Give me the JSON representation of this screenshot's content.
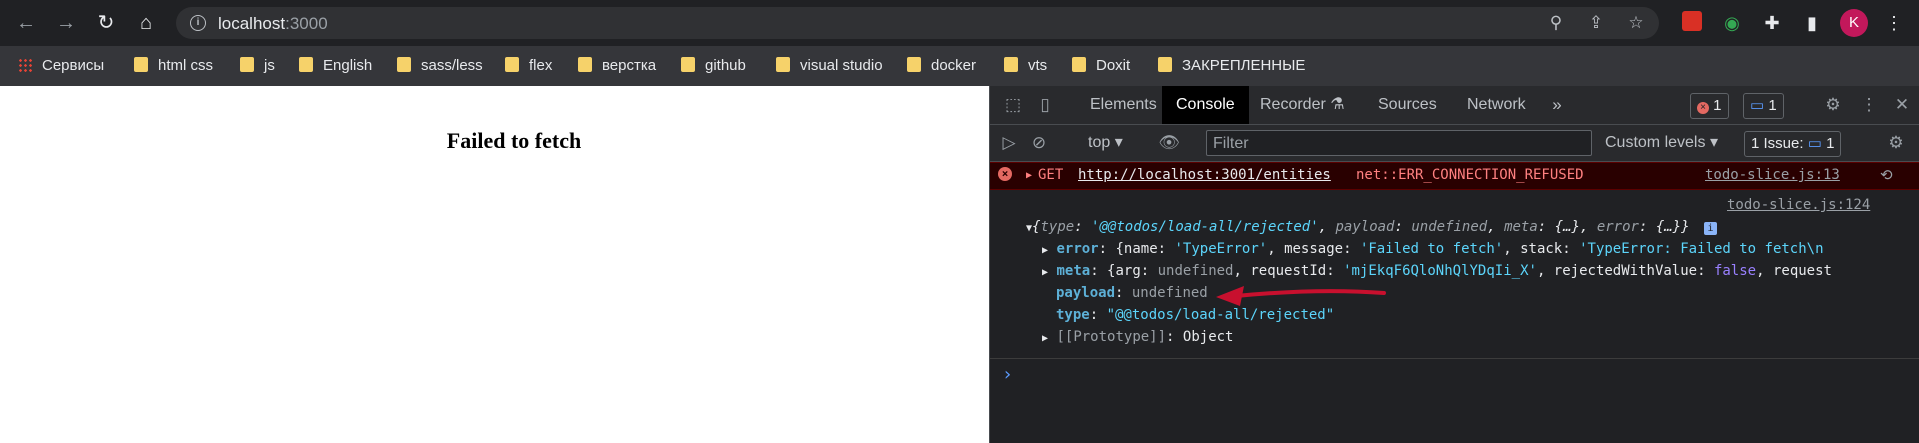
{
  "browser": {
    "url_host": "localhost",
    "url_port": ":3000",
    "avatar_letter": "K"
  },
  "bookmarks": [
    {
      "label": "Сервисы",
      "type": "apps"
    },
    {
      "label": "html css",
      "type": "folder"
    },
    {
      "label": "js",
      "type": "folder"
    },
    {
      "label": "English",
      "type": "folder"
    },
    {
      "label": "sass/less",
      "type": "folder"
    },
    {
      "label": "flex",
      "type": "folder"
    },
    {
      "label": "верстка",
      "type": "folder"
    },
    {
      "label": "github",
      "type": "folder"
    },
    {
      "label": "visual studio",
      "type": "folder"
    },
    {
      "label": "docker",
      "type": "folder"
    },
    {
      "label": "vts",
      "type": "folder"
    },
    {
      "label": "Doxit",
      "type": "folder"
    },
    {
      "label": "ЗАКРЕПЛЕННЫЕ",
      "type": "folder"
    }
  ],
  "page": {
    "message": "Failed to fetch"
  },
  "devtools": {
    "tabs": [
      "Elements",
      "Console",
      "Recorder",
      "Sources",
      "Network"
    ],
    "active_tab": "Console",
    "more_tabs": "»",
    "error_count": "1",
    "message_count": "1",
    "context": "top",
    "filter_placeholder": "Filter",
    "levels": "Custom levels",
    "issues_label": "1 Issue:",
    "issues_count": "1"
  },
  "console": {
    "error": {
      "method": "GET",
      "url": "http://localhost:3001/entities",
      "text": "net::ERR_CONNECTION_REFUSED",
      "source": "todo-slice.js:13"
    },
    "log_source": "todo-slice.js:124",
    "object_summary": {
      "open": "{",
      "type_key": "type",
      "type_val": "'@@todos/load-all/rejected'",
      "payload_key": "payload",
      "payload_val": "undefined",
      "meta_key": "meta",
      "meta_val": "{…}",
      "error_key": "error",
      "error_val": "{…}}",
      "info_badge": "i"
    },
    "props": {
      "error": {
        "key": "error",
        "open": "{name: ",
        "name_val": "'TypeError'",
        "msg_key": ", message: ",
        "msg_val": "'Failed to fetch'",
        "stack_key": ", stack: ",
        "stack_val": "'TypeError: Failed to fetch\\n"
      },
      "meta": {
        "key": "meta",
        "open": "{arg: ",
        "arg_val": "undefined",
        "req_key": ", requestId: ",
        "req_val": "'mjEkqF6QloNhQlYDqIi_X'",
        "rej_key": ", rejectedWithValue: ",
        "rej_val": "false",
        "tail": ", request"
      },
      "payload": {
        "key": "payload",
        "val": "undefined"
      },
      "type": {
        "key": "type",
        "val": "\"@@todos/load-all/rejected\""
      },
      "prototype": {
        "key": "[[Prototype]]",
        "val": "Object"
      }
    },
    "prompt": "›"
  },
  "colors": {
    "annotation_arrow": "#c8102e",
    "error_bg": "#290000",
    "devtools_bg": "#202124"
  }
}
